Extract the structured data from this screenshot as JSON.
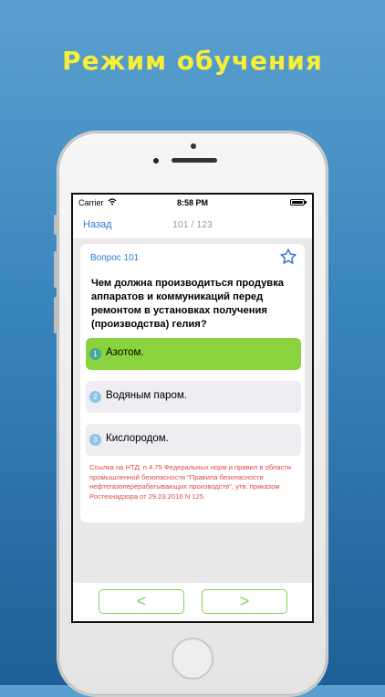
{
  "headline": "Режим обучения",
  "status_bar": {
    "carrier": "Carrier",
    "time": "8:58 PM"
  },
  "nav": {
    "back_label": "Назад",
    "counter": "101 / 123"
  },
  "question": {
    "number_label": "Вопрос 101",
    "text": "Чем должна производиться продувка аппаратов и коммуникаций перед ремонтом в установках получения (производства) гелия?",
    "answers": [
      {
        "num": "1",
        "label": "Азотом.",
        "state": "correct"
      },
      {
        "num": "2",
        "label": "Водяным паром.",
        "state": "neutral"
      },
      {
        "num": "3",
        "label": "Кислородом.",
        "state": "neutral"
      }
    ],
    "reference": "Ссылка на НТД: п.4.75 Федеральных норм и правил в области промышленной безопасности \"Правила безопасности нефтегазоперерабатывающих производств\", утв. приказом Ростехнадзора от 29.03.2016 N 125"
  },
  "controls": {
    "prev_label": "<",
    "next_label": ">"
  },
  "icons": {
    "favorite": "star-outline-icon",
    "wifi": "wifi-icon",
    "battery": "battery-icon"
  },
  "colors": {
    "accent": "#2a7ad6",
    "correct": "#8ad23e",
    "reference": "#e04848",
    "headline": "#f7ee3a"
  }
}
